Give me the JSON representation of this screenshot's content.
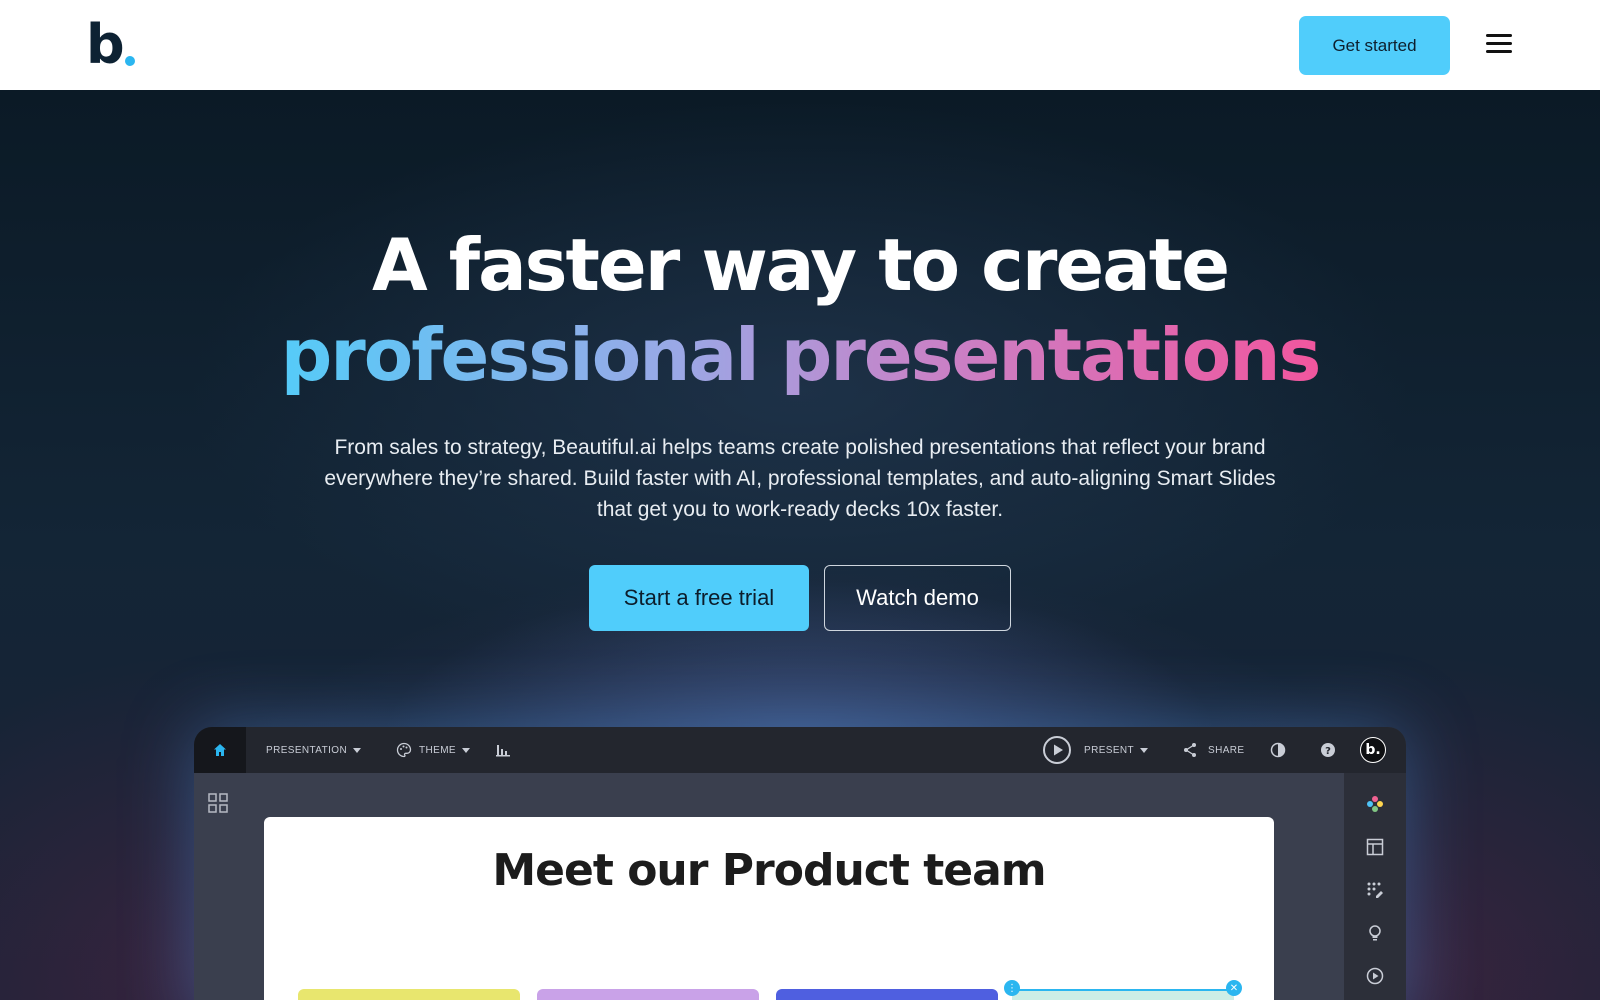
{
  "brand": {
    "logo_letter": "b",
    "accent_color": "#2bb6f0"
  },
  "nav": {
    "cta_label": "Get started",
    "menu_icon": "hamburger-menu-icon"
  },
  "hero": {
    "headline_line1": "A faster way to create",
    "headline_line2": "professional presentations",
    "subtext": "From sales to strategy, Beautiful.ai helps teams create polished presentations that reflect your brand everywhere they’re shared. Build faster with AI, professional templates, and auto-aligning Smart Slides that get you to work-ready decks 10x faster.",
    "primary_cta": "Start a free trial",
    "secondary_cta": "Watch demo",
    "gradient_colors": [
      "#55cbf8",
      "#c783c8",
      "#f1569e"
    ]
  },
  "app": {
    "toolbar": {
      "presentation_label": "PRESENTATION",
      "theme_label": "THEME",
      "present_label": "PRESENT",
      "share_label": "SHARE",
      "avatar_letter": "b."
    },
    "slide": {
      "title": "Meet our Product team",
      "card_colors": [
        "#e8e66e",
        "#c9a2e8",
        "#4f5fe0",
        "#cdeee6"
      ]
    },
    "right_panel_icons": [
      "palette-dots-icon",
      "layout-icon",
      "grid-edit-icon",
      "lightbulb-icon",
      "play-icon"
    ]
  }
}
